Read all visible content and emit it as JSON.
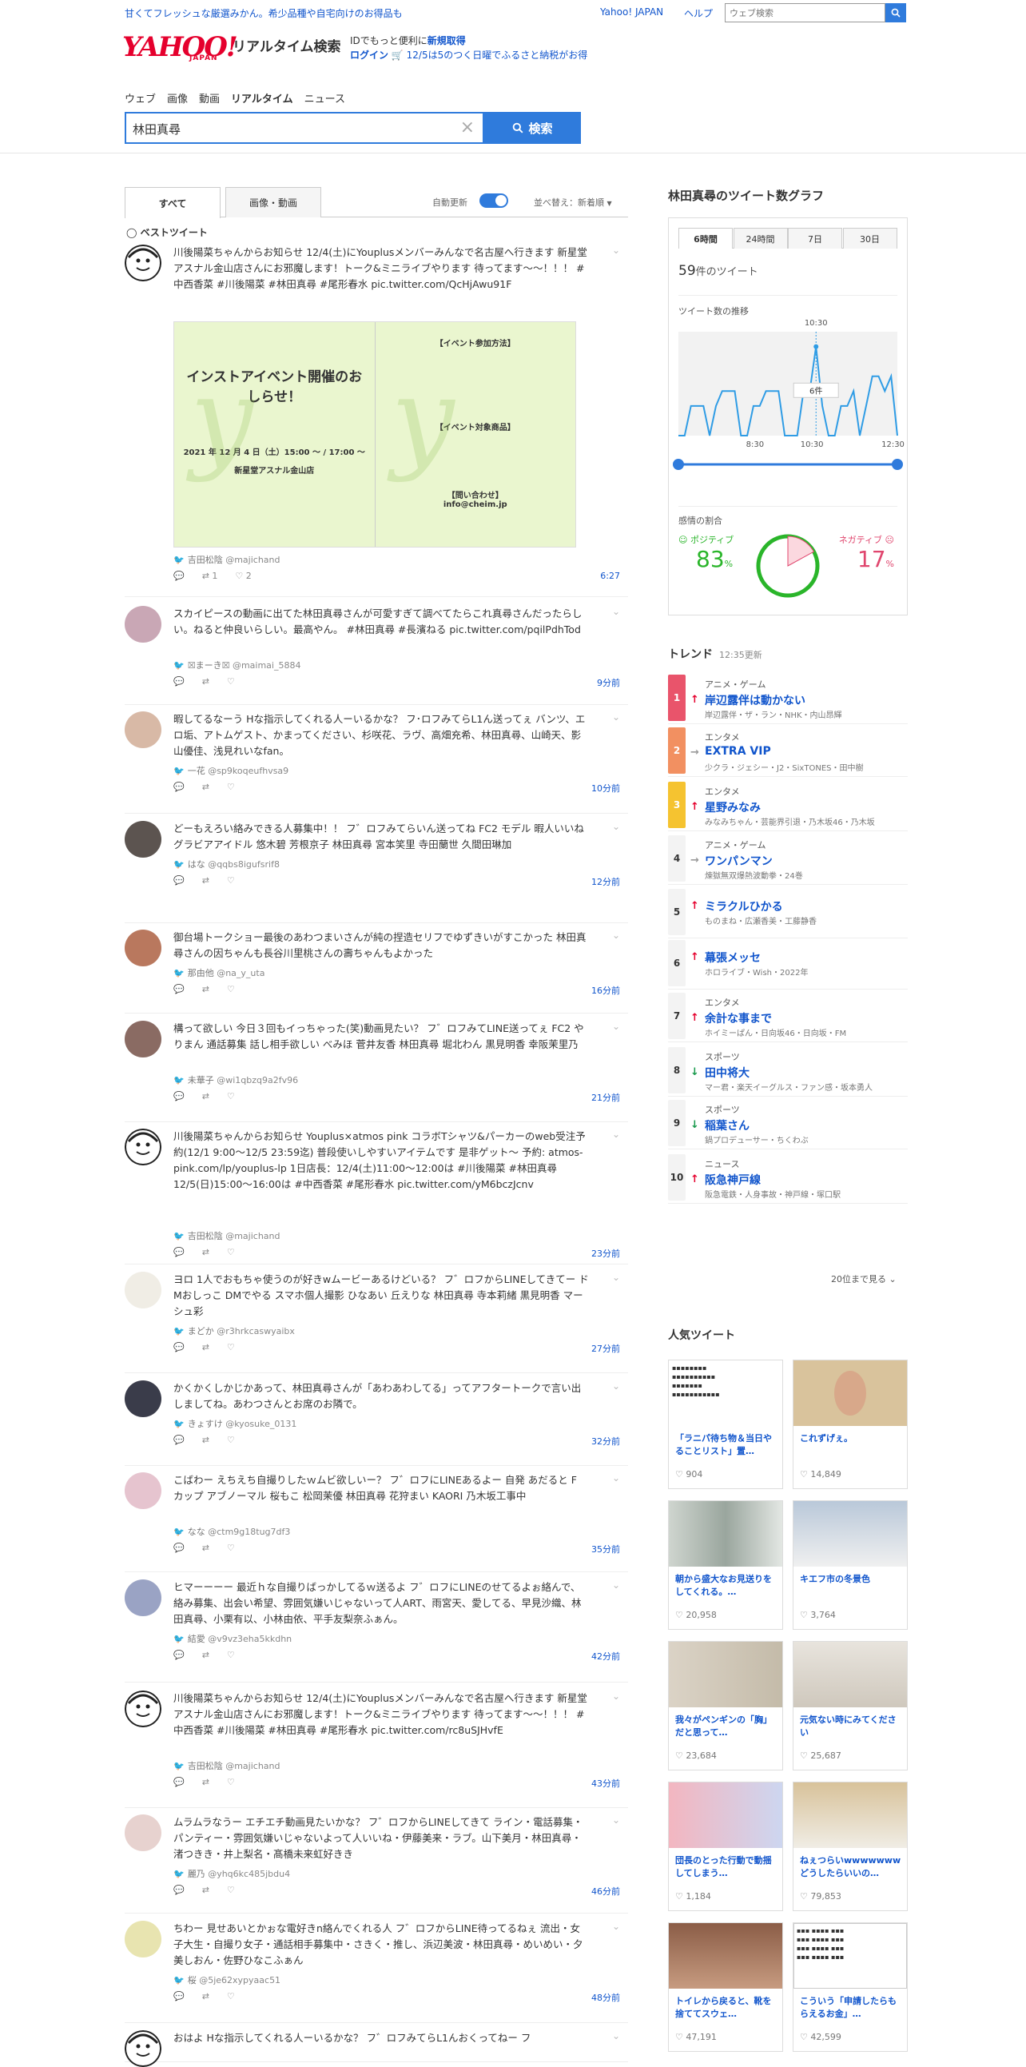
{
  "header": {
    "promo": "甘くてフレッシュな厳選みかん。希少品種や自宅向けのお得品も",
    "yahoo_japan_link": "Yahoo! JAPAN",
    "help_link": "ヘルプ",
    "web_search_placeholder": "ウェブ検索",
    "logo_text": "YAHOO!",
    "logo_sub": "JAPAN",
    "service_name": "リアルタイム検索",
    "login_line1_prefix": "IDでもっと便利に",
    "login_line1_link": "新規取得",
    "login_line2_link": "ログイン",
    "login_line2_text": "12/5は5のつく日曜でふるさと納税がお得"
  },
  "nav": [
    "ウェブ",
    "画像",
    "動画",
    "リアルタイム",
    "ニュース"
  ],
  "nav_active": "リアルタイム",
  "search": {
    "value": "林田真尋",
    "button": "検索"
  },
  "tabs": {
    "all": "すべて",
    "media": "画像・動画"
  },
  "auto_update": "自動更新",
  "sort": "並べ替え：新着順",
  "best_tweet": "ベストツイート",
  "tweets": [
    {
      "text": "川後陽菜ちゃんからお知らせ 12/4(土)にYouplusメンバーみんなで名古屋へ行きます 新星堂アスナル金山店さんにお邪魔します！トーク&ミニライブやります 待ってます〜〜！！！ #中西香菜 #川後陽菜 #林田真尋 #尾形春水 pic.twitter.com/QcHjAwu91F",
      "user": "吉田松陰",
      "handle": "@majichand",
      "time": "6:27",
      "rt": "1",
      "like": "2",
      "media_left_title": "インストアイベント開催のおしらせ！",
      "media_left_date": "2021 年 12 月 4 日（土）15:00 〜 / 17:00 〜",
      "media_left_place": "新星堂アスナル金山店",
      "media_right_t1": "【イベント参加方法】",
      "media_right_t2": "【イベント対象商品】",
      "media_right_t3": "【問い合わせ】",
      "media_right_mail": "info@cheim.jp"
    },
    {
      "text": "スカイピースの動画に出てた林田真尋さんが可愛すぎて調べてたらこれ真尋さんだったらしい。ねると仲良いらしい。最高やん。 #林田真尋 #長濱ねる pic.twitter.com/pqilPdhTod",
      "user": "☒まーき☒",
      "handle": "@maimai_5884",
      "time": "9分前"
    },
    {
      "text": "暇してるなーう Hな指示してくれる人ーいるかな？ フ･ロフみてらL1ん送ってぇ バンツ、エロ垢、アトムゲスト、かまってください、杉咲花、ラヴ、高畑充希、林田真尋、山崎天、影山優佳、浅見れいなfan。",
      "user": "一花",
      "handle": "@sp9koqeufhvsa9",
      "time": "10分前"
    },
    {
      "text": "どーもえろい絡みできる人募集中！！ フ゛ロフみてらいん送ってね FC2 モデル 暇人いいね グラビアアイドル 悠木碧 芳根京子 林田真尋 宮本笑里 寺田蘭世 久間田琳加",
      "user": "はな",
      "handle": "@qqbs8igufsrif8",
      "time": "12分前"
    },
    {
      "text": "御台場トークショー最後のあわつまいさんが純の捏造セリフでゆずきいがすこかった 林田真尋さんの因ちゃんも長谷川里桃さんの壽ちゃんもよかった",
      "user": "那由他",
      "handle": "@na_y_uta",
      "time": "16分前"
    },
    {
      "text": "構って欲しい 今日３回もイっちゃった(笑)動画見たい？ フ゛ロフみてLINE送ってぇ FC2 やりまん 通話募集 話し相手欲しい べみほ 菅井友香 林田真尋 堀北わん 黒見明香 幸阪茉里乃",
      "user": "未華子",
      "handle": "@wi1qbzq9a2fv96",
      "time": "21分前"
    },
    {
      "text": "川後陽菜ちゃんからお知らせ Youplus×atmos pink コラボTシャツ&パーカーのweb受注予約(12/1 9:00〜12/5 23:59迄) 普段使いしやすいアイテムです 是非ゲット〜 予約: atmos-pink.com/lp/youplus-lp 1日店長：12/4(土)11:00〜12:00は #川後陽菜 #林田真尋 12/5(日)15:00〜16:00は #中西香菜 #尾形春水 pic.twitter.com/yM6bczJcnv",
      "user": "吉田松陰",
      "handle": "@majichand",
      "time": "23分前"
    },
    {
      "text": "ヨロ 1人でおもちゃ使うのが好きwムービーあるけどいる？ フ゛ロフからLINEしてきてー ドMおしっこ DMでやる スマホ個人撮影 ひなあい 丘えりな 林田真尋 寺本莉緒 黒見明香 マーシュ彩",
      "user": "まどか",
      "handle": "@r3hrkcaswyaibx",
      "time": "27分前"
    },
    {
      "text": "かくかくしかじかあって、林田真尋さんが「あわあわしてる」ってアフタートークで言い出しましてね。あわつさんとお席のお隣で。",
      "user": "きょすけ",
      "handle": "@kyosuke_0131",
      "time": "32分前"
    },
    {
      "text": "こばわー えちえち自撮りしたｗムビ欲しいー？ フ゛ロフにLINEあるよー 自発 あだると F カップ アブノーマル 桜もこ 松岡茉優 林田真尋 花狩まい KAORI 乃木坂工事中",
      "user": "なな",
      "handle": "@ctm9g18tug7df3",
      "time": "35分前"
    },
    {
      "text": "ヒマーーーー 最近ｈな自撮りばっかしてるｗ送るよ フ゛ロフにLINEのせてるよぉ絡んで、絡み募集、出会い希望、雰囲気嫌いじゃないって人ART、雨宮天、愛してる、早見沙織、林田真尋、小栗有以、小林由依、平手友梨奈ふぁん。",
      "user": "結愛",
      "handle": "@v9vz3eha5kkdhn",
      "time": "42分前"
    },
    {
      "text": "川後陽菜ちゃんからお知らせ 12/4(土)にYouplusメンバーみんなで名古屋へ行きます 新星堂アスナル金山店さんにお邪魔します！トーク&ミニライブやります 待ってます〜〜！！！ #中西香菜 #川後陽菜 #林田真尋 #尾形春水 pic.twitter.com/rc8uSJHvfE",
      "user": "吉田松陰",
      "handle": "@majichand",
      "time": "43分前"
    },
    {
      "text": "ムラムラなうー エチエチ動画見たいかな？ フ゛ロフからLINEしてきて ライン・電話募集・パンティー・雰囲気嫌いじゃないよって人いいね・伊藤美来・ラブ。山下美月・林田真尋・渚つきき・井上梨名・髙橋未来虹好きき",
      "user": "麗乃",
      "handle": "@yhq6kc485jbdu4",
      "time": "46分前"
    },
    {
      "text": "ちわー 見せあいとかぉな電好きn絡んでくれる人 フ゛ロフからLINE待ってるねぇ 流出・女子大生・自撮り女子・通話相手募集中・さきく・推し、浜辺美波・林田真尋・めいめい・夕美しおん・佐野ひなこふぁん",
      "user": "桜",
      "handle": "@5je62xypyaac51",
      "time": "48分前"
    },
    {
      "text": "おはよ Hな指示してくれる人ーいるかな？ フ゛ロフみてらL1んおくってねー フ",
      "user": "",
      "handle": "",
      "time": ""
    }
  ],
  "graph": {
    "title": "林田真尋のツイート数グラフ",
    "tabs": [
      "6時間",
      "24時間",
      "7日",
      "30日"
    ],
    "active_tab": "6時間",
    "count": "59",
    "count_suffix": "件のツイート",
    "trend_label": "ツイート数の推移",
    "top_time": "10:30",
    "x_ticks": [
      "8:30",
      "10:30",
      "12:30"
    ],
    "tooltip": "6件",
    "emotion_label": "感情の割合",
    "positive_label": "ポジティブ",
    "positive_value": "83",
    "negative_label": "ネガティブ",
    "negative_value": "17",
    "percent": "%"
  },
  "chart_data": {
    "type": "line",
    "x": [
      0,
      1,
      2,
      3,
      4,
      5,
      6,
      7,
      8,
      9,
      10,
      11,
      12,
      13,
      14,
      15,
      16,
      17,
      18,
      19,
      20,
      21,
      22,
      23,
      24,
      25,
      26,
      27,
      28,
      29,
      30,
      31,
      32,
      33,
      34,
      35
    ],
    "values": [
      0,
      0,
      2,
      2,
      2,
      0,
      2,
      3,
      3,
      3,
      0,
      0,
      2,
      2,
      3,
      3,
      3,
      0,
      0,
      0,
      3,
      3,
      6,
      2,
      0,
      0,
      2,
      2,
      3,
      0,
      2,
      4,
      4,
      3,
      4,
      0
    ],
    "xlabel": "",
    "ylabel": "",
    "x_ticks": [
      "8:30",
      "10:30",
      "12:30"
    ],
    "highlight_value": "6件",
    "color": "#2f9ce5"
  },
  "trends": {
    "title": "トレンド",
    "updated": "12:35更新",
    "items": [
      {
        "rank": "1",
        "category": "アニメ・ゲーム",
        "dir": "↑",
        "keyword": "岸辺露伴は動かない",
        "related": "岸辺露伴・ザ・ラン・NHK・内山昂輝",
        "color": "#e9546b"
      },
      {
        "rank": "2",
        "category": "エンタメ",
        "dir": "→",
        "keyword": "EXTRA VIP",
        "related": "少クラ・ジェシー・J2・SixTONES・田中樹",
        "color": "#f29061"
      },
      {
        "rank": "3",
        "category": "エンタメ",
        "dir": "↑",
        "keyword": "星野みなみ",
        "related": "みなみちゃん・芸能界引退・乃木坂46・乃木坂",
        "color": "#f5c330"
      },
      {
        "rank": "4",
        "category": "アニメ・ゲーム",
        "dir": "→",
        "keyword": "ワンパンマン",
        "related": "煉獄無双爆熱波動拳・24巻",
        "color": ""
      },
      {
        "rank": "5",
        "category": "",
        "dir": "↑",
        "keyword": "ミラクルひかる",
        "related": "ものまね・広瀬香美・工藤静香",
        "color": ""
      },
      {
        "rank": "6",
        "category": "",
        "dir": "↑",
        "keyword": "幕張メッセ",
        "related": "ホロライブ・Wish・2022年",
        "color": ""
      },
      {
        "rank": "7",
        "category": "エンタメ",
        "dir": "↑",
        "keyword": "余計な事まで",
        "related": "ホイミーぱん・日向坂46・日向坂・FM",
        "color": ""
      },
      {
        "rank": "8",
        "category": "スポーツ",
        "dir": "↓",
        "keyword": "田中将大",
        "related": "マー君・楽天イーグルス・ファン感・坂本勇人",
        "color": ""
      },
      {
        "rank": "9",
        "category": "スポーツ",
        "dir": "↓",
        "keyword": "稲葉さん",
        "related": "鍋プロデューサー・ちくわぶ",
        "color": ""
      },
      {
        "rank": "10",
        "category": "ニュース",
        "dir": "↑",
        "keyword": "阪急神戸線",
        "related": "阪急電鉄・人身事故・神戸線・塚口駅",
        "color": ""
      }
    ],
    "more": "20位まで見る"
  },
  "popular": {
    "title": "人気ツイート",
    "cards": [
      {
        "text": "「ラニパ待ち物＆当日やることリスト」置…",
        "likes": "904",
        "img": "doc"
      },
      {
        "text": "これずげぇ。",
        "likes": "14,849",
        "img": "face"
      },
      {
        "text": "朝から盛大なお見送りをしてくれる。…",
        "likes": "20,958",
        "img": "curtain"
      },
      {
        "text": "キエフ市の冬景色",
        "likes": "3,764",
        "img": "snow"
      },
      {
        "text": "我々がペンギンの「胸」だと思って…",
        "likes": "23,684",
        "img": "penguin"
      },
      {
        "text": "元気ない時にみてください",
        "likes": "25,687",
        "img": "cat"
      },
      {
        "text": "団長のとった行動で動揺してしまう…",
        "likes": "1,184",
        "img": "anime"
      },
      {
        "text": "ねぇつらいwwwwwwwどうしたらいいの…",
        "likes": "79,853",
        "img": "milk"
      },
      {
        "text": "トイレから戻ると、靴を捨ててスウェ…",
        "likes": "47,191",
        "img": "room"
      },
      {
        "text": "こういう「申請したらもらえるお金」…",
        "likes": "42,599",
        "img": "table"
      }
    ]
  }
}
